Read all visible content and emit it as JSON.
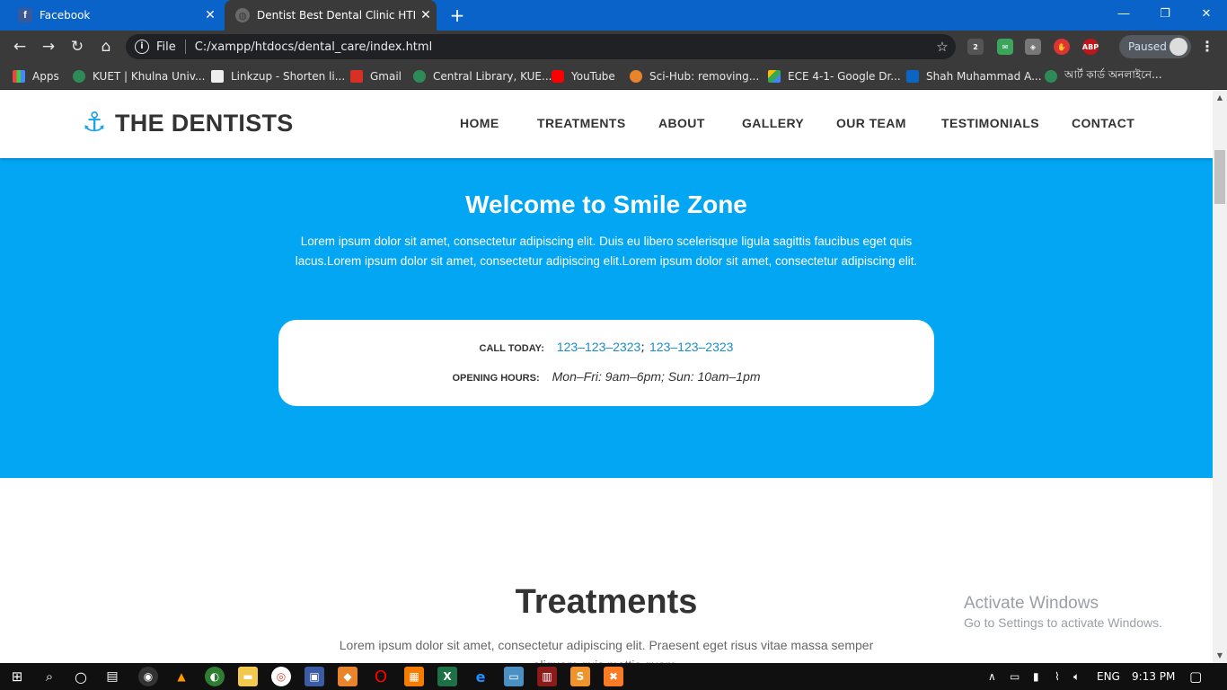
{
  "browser": {
    "tabs": [
      {
        "title": "Facebook",
        "active": false
      },
      {
        "title": "Dentist Best Dental Clinic HTML \\",
        "active": true
      }
    ],
    "address": {
      "scheme_label": "File",
      "url": "C:/xampp/htdocs/dental_care/index.html"
    },
    "profile_label": "Paused",
    "extension_badge": "2",
    "abp_label": "ABP",
    "bookmarks": [
      {
        "label": "Apps"
      },
      {
        "label": "KUET | Khulna Univ..."
      },
      {
        "label": "Linkzup - Shorten li..."
      },
      {
        "label": "Gmail"
      },
      {
        "label": "Central Library, KUE..."
      },
      {
        "label": "YouTube"
      },
      {
        "label": "Sci-Hub: removing..."
      },
      {
        "label": "ECE 4-1- Google Dr..."
      },
      {
        "label": "Shah Muhammad A..."
      },
      {
        "label": "আর্ট কার্ড অনলাইনে..."
      }
    ]
  },
  "site": {
    "brand": "THE DENTISTS",
    "nav": [
      "HOME",
      "TREATMENTS",
      "ABOUT",
      "GALLERY",
      "OUR TEAM",
      "TESTIMONIALS",
      "CONTACT"
    ],
    "hero": {
      "title": "Welcome to Smile Zone",
      "text": "Lorem ipsum dolor sit amet, consectetur adipiscing elit. Duis eu libero scelerisque ligula sagittis faucibus eget quis lacus.Lorem ipsum dolor sit amet, consectetur adipiscing elit.Lorem ipsum dolor sit amet, consectetur adipiscing elit.",
      "call_label": "CALL TODAY:",
      "phone1": "123–123–2323",
      "phone_sep": ";",
      "phone2": "123–123–2323",
      "hours_label": "OPENING HOURS:",
      "hours": "Mon–Fri: 9am–6pm; Sun: 10am–1pm"
    },
    "treatments": {
      "title": "Treatments",
      "text": "Lorem ipsum dolor sit amet, consectetur adipiscing elit. Praesent eget risus vitae massa semper aliquam quis mattis quam."
    }
  },
  "watermark": {
    "line1": "Activate Windows",
    "line2": "Go to Settings to activate Windows."
  },
  "taskbar": {
    "language": "ENG",
    "time": "9:13 PM"
  },
  "colors": {
    "hero_bg": "#02a6f2",
    "link": "#1b8ccc",
    "tabbar": "#0a63c9"
  }
}
